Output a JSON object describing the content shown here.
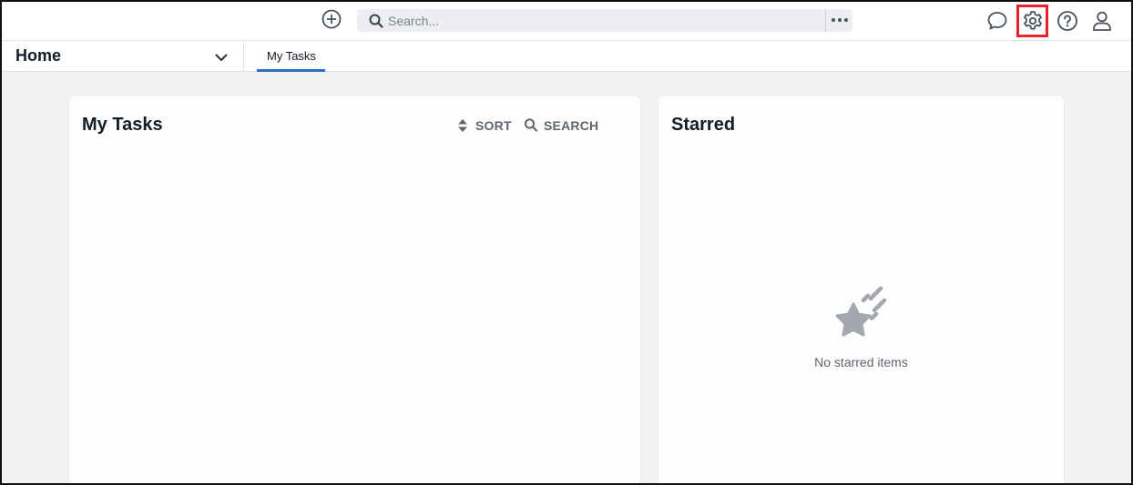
{
  "header": {
    "add_icon": "plus-circle-icon",
    "search": {
      "placeholder": "Search..."
    },
    "icons": [
      "chat-icon",
      "gear-icon",
      "help-icon",
      "user-icon"
    ],
    "highlight_color": "#e5242b"
  },
  "nav": {
    "selector_label": "Home",
    "tabs": [
      {
        "label": "My Tasks",
        "active": true
      }
    ],
    "accent": "#2a6ec9"
  },
  "tasks_card": {
    "title": "My Tasks",
    "sort_label": "SORT",
    "search_label": "SEARCH"
  },
  "starred_card": {
    "title": "Starred",
    "empty_text": "No starred items",
    "empty_icon": "shooting-star-icon"
  }
}
